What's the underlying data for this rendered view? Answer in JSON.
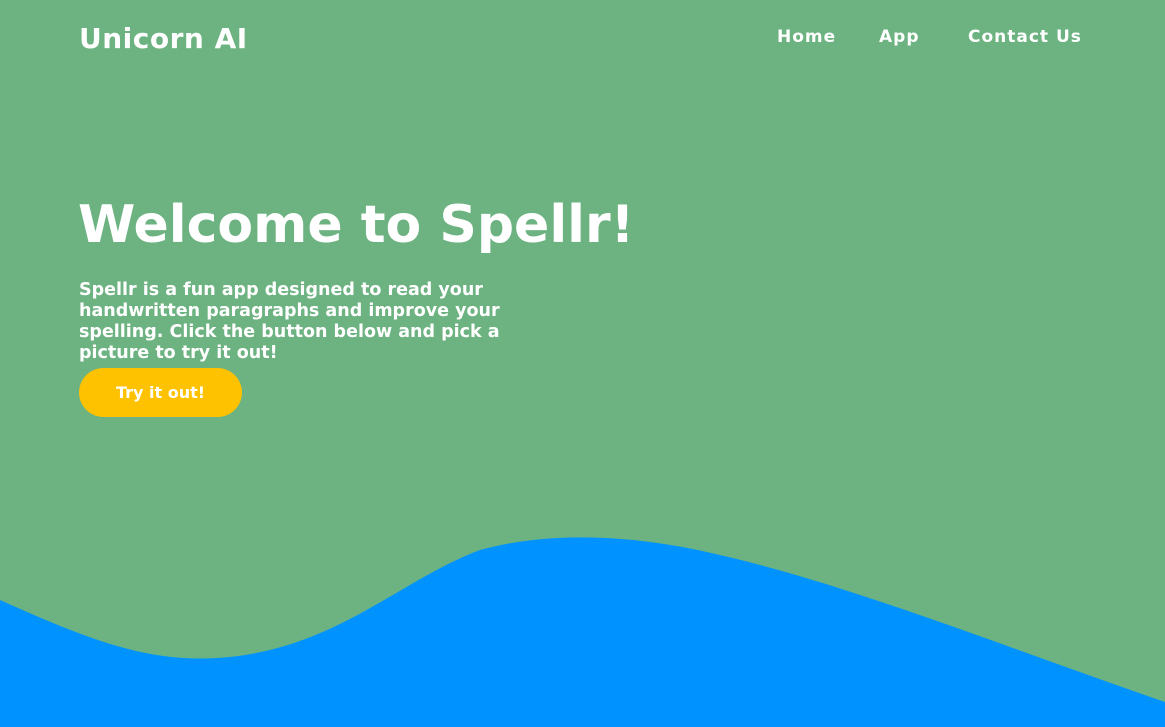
{
  "header": {
    "brand": "Unicorn AI",
    "nav": [
      {
        "label": "Home"
      },
      {
        "label": "App"
      },
      {
        "label": "Contact Us"
      }
    ]
  },
  "hero": {
    "title": "Welcome to Spellr!",
    "description": "Spellr is a fun app designed to read your handwritten paragraphs and improve your spelling. Click the button below and pick a picture to try it out!",
    "cta_label": "Try it out!"
  },
  "colors": {
    "background": "#6db381",
    "wave": "#0093ff",
    "cta": "#ffc200",
    "text": "#ffffff"
  }
}
